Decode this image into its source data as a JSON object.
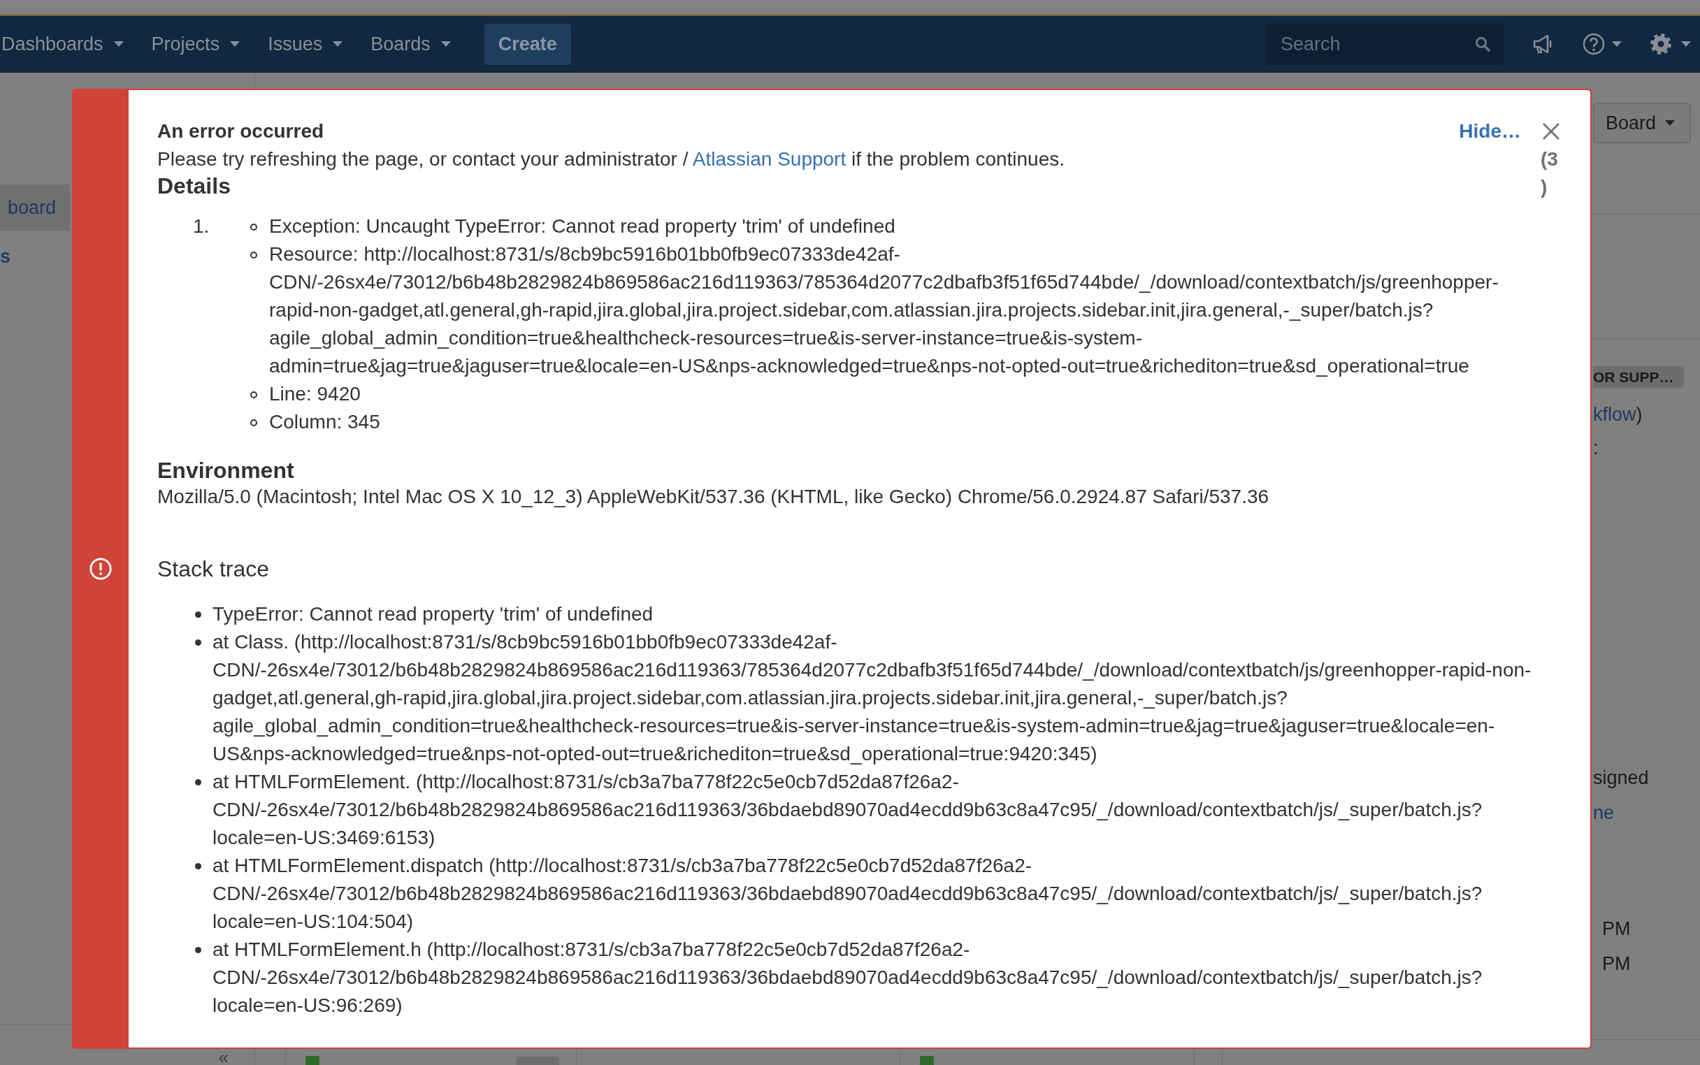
{
  "navbar": {
    "menus": [
      {
        "label": "Dashboards"
      },
      {
        "label": "Projects"
      },
      {
        "label": "Issues"
      },
      {
        "label": "Boards"
      }
    ],
    "create_button": "Create",
    "search": {
      "placeholder": "Search"
    }
  },
  "sidebar": {
    "items": [
      {
        "kind": "link",
        "label": "board",
        "selected": true
      },
      {
        "kind": "bold-link",
        "label": "s",
        "selected": false
      }
    ],
    "collapse": "«"
  },
  "board_panel": {
    "board_button": "Board",
    "sections": [
      {
        "items": [
          {
            "kind": "badge",
            "text": "OR SUPP…"
          },
          {
            "kind": "link",
            "text": "kflow",
            "after": ")"
          },
          {
            "kind": "text",
            "text": ":"
          }
        ]
      },
      {
        "items": [
          {
            "kind": "text",
            "text": "signed"
          },
          {
            "kind": "link",
            "text": "ne"
          }
        ]
      },
      {
        "items": [
          {
            "kind": "text",
            "text": "PM"
          },
          {
            "kind": "text",
            "text": "PM"
          }
        ]
      }
    ]
  },
  "error_dialog": {
    "title": "An error occurred",
    "message": {
      "before": "Please try refreshing the page, or contact your administrator / ",
      "link": "Atlassian Support",
      "after": " if the problem continues."
    },
    "hide_link": "Hide…",
    "count": "(3)",
    "details": {
      "heading": "Details",
      "items": [
        {
          "number": "1.",
          "children": [
            {
              "text": "Exception: Uncaught TypeError: Cannot read property 'trim' of undefined"
            },
            {
              "text": "Resource: http://localhost:8731/s/8cb9bc5916b01bb0fb9ec07333de42af-CDN/-26sx4e/73012/b6b48b2829824b869586ac216d119363/785364d2077c2dbafb3f51f65d744bde/_/download/contextbatch/js/greenhopper-rapid-non-gadget,atl.general,gh-rapid,jira.global,jira.project.sidebar,com.atlassian.jira.projects.sidebar.init,jira.general,-_super/batch.js?agile_global_admin_condition=true&healthcheck-resources=true&is-server-instance=true&is-system-admin=true&jag=true&jaguser=true&locale=en-US&nps-acknowledged=true&nps-not-opted-out=true&richediton=true&sd_operational=true"
            },
            {
              "text": "Line: 9420"
            },
            {
              "text": "Column: 345"
            }
          ]
        }
      ]
    },
    "environment": {
      "heading": "Environment",
      "text": "Mozilla/5.0 (Macintosh; Intel Mac OS X 10_12_3) AppleWebKit/537.36 (KHTML, like Gecko) Chrome/56.0.2924.87 Safari/537.36"
    },
    "stack_trace": {
      "heading": "Stack trace",
      "lines": [
        "TypeError: Cannot read property 'trim' of undefined",
        "at Class. (http://localhost:8731/s/8cb9bc5916b01bb0fb9ec07333de42af-CDN/-26sx4e/73012/b6b48b2829824b869586ac216d119363/785364d2077c2dbafb3f51f65d744bde/_/download/contextbatch/js/greenhopper-rapid-non-gadget,atl.general,gh-rapid,jira.global,jira.project.sidebar,com.atlassian.jira.projects.sidebar.init,jira.general,-_super/batch.js?agile_global_admin_condition=true&healthcheck-resources=true&is-server-instance=true&is-system-admin=true&jag=true&jaguser=true&locale=en-US&nps-acknowledged=true&nps-not-opted-out=true&richediton=true&sd_operational=true:9420:345)",
        "at HTMLFormElement. (http://localhost:8731/s/cb3a7ba778f22c5e0cb7d52da87f26a2-CDN/-26sx4e/73012/b6b48b2829824b869586ac216d119363/36bdaebd89070ad4ecdd9b63c8a47c95/_/download/contextbatch/js/_super/batch.js?locale=en-US:3469:6153)",
        "at HTMLFormElement.dispatch (http://localhost:8731/s/cb3a7ba778f22c5e0cb7d52da87f26a2-CDN/-26sx4e/73012/b6b48b2829824b869586ac216d119363/36bdaebd89070ad4ecdd9b63c8a47c95/_/download/contextbatch/js/_super/batch.js?locale=en-US:104:504)",
        "at HTMLFormElement.h (http://localhost:8731/s/cb3a7ba778f22c5e0cb7d52da87f26a2-CDN/-26sx4e/73012/b6b48b2829824b869586ac216d119363/36bdaebd89070ad4ecdd9b63c8a47c95/_/download/contextbatch/js/_super/batch.js?locale=en-US:96:269)"
      ]
    }
  }
}
